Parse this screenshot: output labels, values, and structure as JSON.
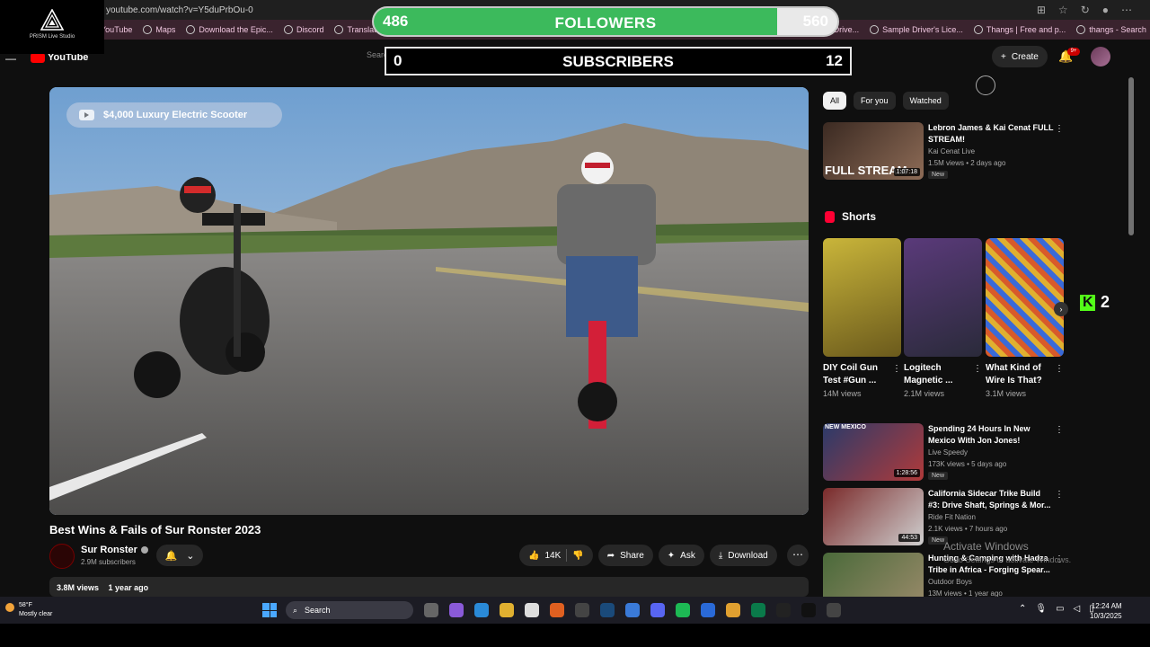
{
  "browser": {
    "url": "youtube.com/watch?v=Y5duPrbOu-0",
    "bookmarks": [
      {
        "label": "YouTube"
      },
      {
        "label": "Maps"
      },
      {
        "label": "Download the Epic..."
      },
      {
        "label": "Discord"
      },
      {
        "label": "Translate"
      },
      {
        "label": "Class C Drive..."
      },
      {
        "label": "Sample Driver's Lice..."
      },
      {
        "label": "Thangs | Free and p..."
      },
      {
        "label": "thangs - Search"
      }
    ]
  },
  "prism": {
    "label": "PRISM Live Studio"
  },
  "followers_overlay": {
    "current": "486",
    "title": "FOLLOWERS",
    "goal": "560",
    "progress_fraction": 0.87
  },
  "subscribers_overlay": {
    "current": "0",
    "title": "SUBSCRIBERS",
    "goal": "12"
  },
  "youtube_header": {
    "logo_text": "YouTube",
    "search_placeholder": "Search",
    "create_label": "Create",
    "notification_badge": "9+"
  },
  "video": {
    "overlay_title": "$4,000 Luxury Electric Scooter",
    "title": "Best Wins & Fails of Sur Ronster 2023",
    "channel": "Sur Ronster",
    "subscribers": "2.9M subscribers",
    "likes": "14K",
    "share_label": "Share",
    "ask_label": "Ask",
    "download_label": "Download",
    "views": "3.8M views",
    "age": "1 year ago"
  },
  "chips": [
    {
      "label": "All",
      "active": true
    },
    {
      "label": "For you",
      "active": false
    },
    {
      "label": "Watched",
      "active": false
    }
  ],
  "recommendations": [
    {
      "title": "Lebron James & Kai Cenat FULL STREAM!",
      "channel": "Kai Cenat Live",
      "meta": "1.5M views • 2 days ago",
      "badge": "New",
      "duration": "1:07:18",
      "thumb_text": "FULL STREAM"
    },
    {
      "title": "Spending 24 Hours In New Mexico With Jon Jones!",
      "channel": "Live Speedy",
      "meta": "173K views • 5 days ago",
      "badge": "New",
      "duration": "1:28:56",
      "thumb_text": "NEW MEXICO"
    },
    {
      "title": "California Sidecar Trike Build #3: Drive Shaft, Springs & Mor...",
      "channel": "Ride Fit Nation",
      "meta": "2.1K views • 7 hours ago",
      "badge": "New",
      "duration": "44:53"
    },
    {
      "title": "Hunting & Camping with Hadza Tribe in Africa - Forging Spear...",
      "channel": "Outdoor Boys",
      "meta": "13M views • 1 year ago"
    }
  ],
  "shorts": {
    "heading": "Shorts",
    "items": [
      {
        "title": "DIY Coil Gun Test #Gun ...",
        "views": "14M views"
      },
      {
        "title": "Logitech Magnetic ...",
        "views": "2.1M views"
      },
      {
        "title": "What Kind of Wire Is That?",
        "views": "3.1M views"
      }
    ]
  },
  "kick_overlay": {
    "count": "2"
  },
  "windows_notice": {
    "title": "Activate Windows",
    "subtitle": "Go to Settings to activate Windows."
  },
  "taskbar": {
    "weather_temp": "58°F",
    "weather_desc": "Mostly clear",
    "search_label": "Search",
    "time": "12:24 AM",
    "date": "10/3/2025"
  }
}
